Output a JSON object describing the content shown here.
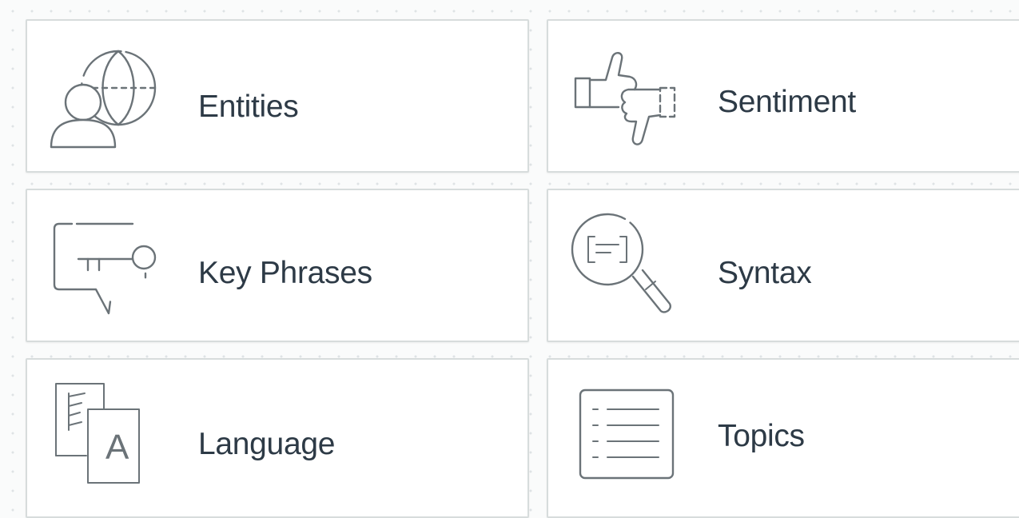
{
  "features": [
    {
      "label": "Entities",
      "icon": "entities-icon"
    },
    {
      "label": "Sentiment",
      "icon": "sentiment-icon"
    },
    {
      "label": "Key Phrases",
      "icon": "key-phrases-icon"
    },
    {
      "label": "Syntax",
      "icon": "syntax-icon"
    },
    {
      "label": "Language",
      "icon": "language-icon"
    },
    {
      "label": "Topics",
      "icon": "topics-icon"
    }
  ],
  "icon_glyphs": {
    "language_letter": "A"
  },
  "colors": {
    "background": "#fafbfb",
    "card_background": "#ffffff",
    "card_border": "#d7dcdc",
    "label_text": "#2d3a46",
    "icon_stroke": "#6b7378"
  }
}
